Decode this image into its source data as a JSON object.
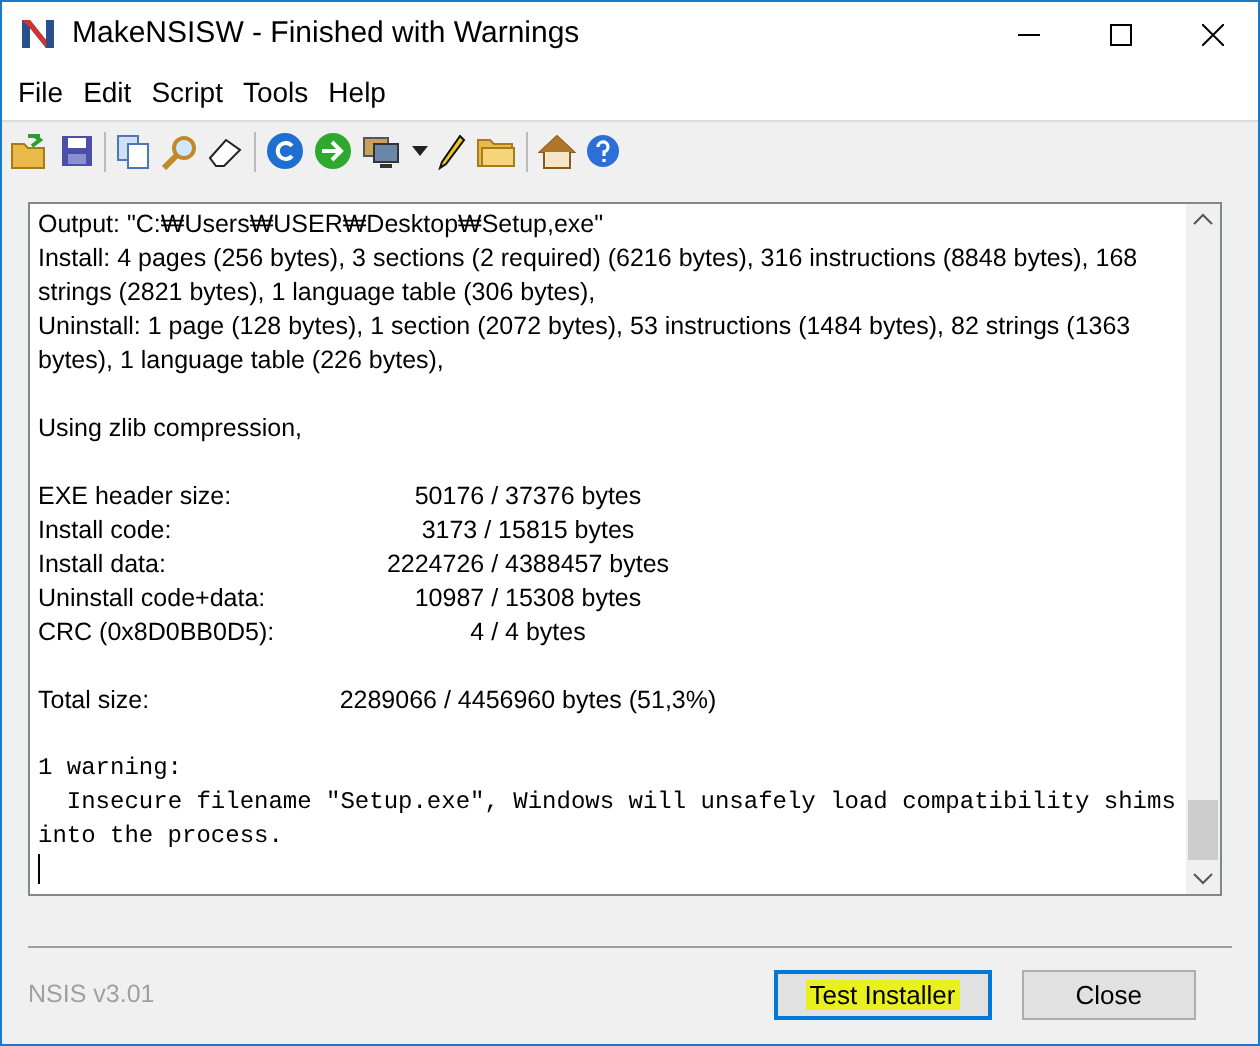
{
  "window": {
    "title": "MakeNSISW - Finished with Warnings"
  },
  "menu": [
    "File",
    "Edit",
    "Script",
    "Tools",
    "Help"
  ],
  "log": [
    {
      "kind": "text",
      "text": "Output: \"C:₩Users₩USER₩Desktop₩Setup,exe\""
    },
    {
      "kind": "text",
      "text": "Install: 4 pages (256 bytes), 3 sections (2 required) (6216 bytes), 316 instructions (8848 bytes), 168 strings (2821 bytes), 1 language table (306 bytes),"
    },
    {
      "kind": "text",
      "text": "Uninstall: 1 page (128 bytes), 1 section (2072 bytes), 53 instructions (1484 bytes), 82 strings (1363 bytes), 1 language table (226 bytes),"
    },
    {
      "kind": "blank"
    },
    {
      "kind": "text",
      "text": "Using zlib compression,"
    },
    {
      "kind": "blank"
    },
    {
      "kind": "size",
      "label": "EXE header size:",
      "value": "50176 / 37376 bytes"
    },
    {
      "kind": "size",
      "label": "Install code:",
      "value": "3173 / 15815 bytes"
    },
    {
      "kind": "size",
      "label": "Install data:",
      "value": "2224726 / 4388457 bytes"
    },
    {
      "kind": "size",
      "label": "Uninstall code+data:",
      "value": "10987 / 15308 bytes"
    },
    {
      "kind": "size",
      "label": "CRC (0x8D0BB0D5):",
      "value": "4 / 4 bytes"
    },
    {
      "kind": "blank"
    },
    {
      "kind": "size",
      "label": "Total size:",
      "value": "2289066 / 4456960 bytes (51,3%)"
    },
    {
      "kind": "blank"
    },
    {
      "kind": "mono",
      "text": "1 warning:"
    },
    {
      "kind": "mono",
      "text": "  Insecure filename \"Setup.exe\", Windows will unsafely load compatibility shims into the process."
    }
  ],
  "footer": {
    "version": "NSIS v3.01"
  },
  "buttons": [
    {
      "label": "Test Installer",
      "selected": true
    },
    {
      "label": "Close",
      "selected": false
    }
  ]
}
